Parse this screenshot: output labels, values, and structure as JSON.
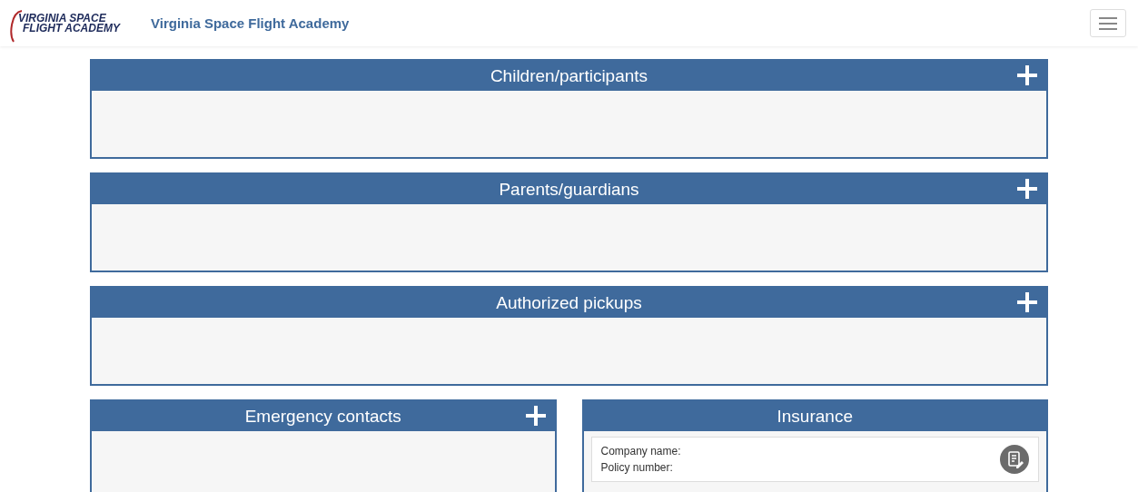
{
  "navbar": {
    "logo_lines": [
      "VIRGINIA SPACE",
      "FLIGHT ACADEMY"
    ],
    "brand": "Virginia Space Flight Academy"
  },
  "sections": [
    {
      "title": "Children/participants",
      "addable": true
    },
    {
      "title": "Parents/guardians",
      "addable": true
    },
    {
      "title": "Authorized pickups",
      "addable": true
    }
  ],
  "columns": [
    {
      "title": "Emergency contacts",
      "addable": true
    },
    {
      "title": "Insurance",
      "addable": false,
      "fields": [
        "Company name:",
        "Policy number:"
      ]
    }
  ]
}
